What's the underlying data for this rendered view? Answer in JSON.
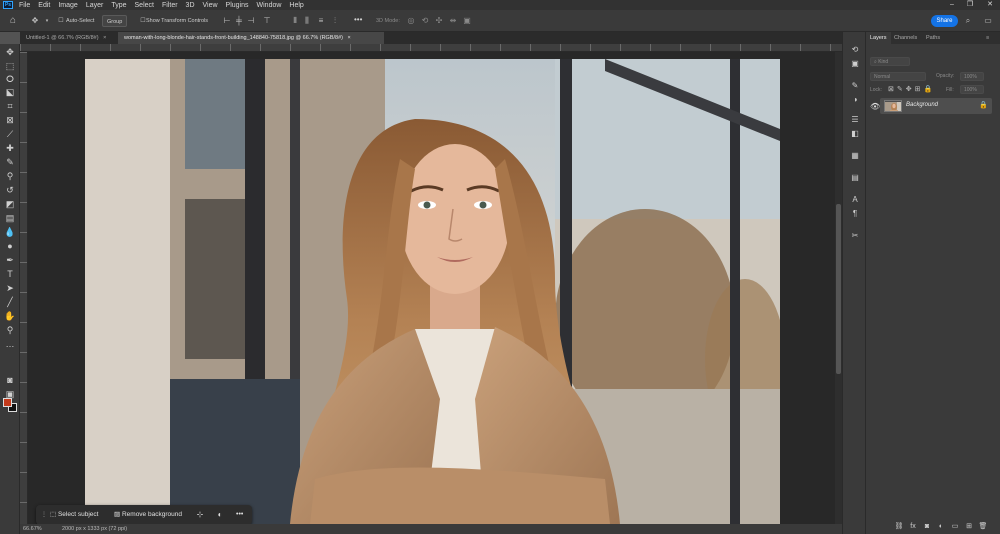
{
  "menubar": {
    "app_logo": "Ps",
    "items": [
      "File",
      "Edit",
      "Image",
      "Layer",
      "Type",
      "Select",
      "Filter",
      "3D",
      "View",
      "Plugins",
      "Window",
      "Help"
    ],
    "window_controls": [
      "–",
      "❐",
      "✕"
    ]
  },
  "options_bar": {
    "home_icon": "home-icon",
    "move_icon": "move-tool-icon",
    "auto_select_label": "Auto-Select",
    "auto_select_value": "Group",
    "show_transform_label": "Show Transform Controls",
    "more_label": "•••",
    "mode_3d_label": "3D Mode:",
    "share_label": "Share"
  },
  "tabs": [
    {
      "label": "Untitled-1 @ 66.7% (RGB/8#)",
      "close": "×"
    },
    {
      "label": "woman-with-long-blonde-hair-stands-front-building_148840-75818.jpg @ 66.7% (RGB/8#)",
      "close": "×"
    }
  ],
  "taskbar": {
    "select_subject_label": "Select subject",
    "remove_background_label": "Remove background",
    "more_label": "•••"
  },
  "statusbar": {
    "zoom": "66.67%",
    "doc_info": "2000 px x 1333 px (72 ppi)"
  },
  "layers_panel": {
    "tabs": [
      "Layers",
      "Channels",
      "Paths"
    ],
    "blend_mode": "Normal",
    "opacity_label": "Opacity:",
    "opacity_value": "100%",
    "lock_label": "Lock:",
    "fill_label": "Fill:",
    "fill_value": "100%",
    "layer_name": "Background"
  },
  "colors": {
    "foreground": "#c43a1b",
    "background": "#111111",
    "accent": "#1473e6"
  }
}
